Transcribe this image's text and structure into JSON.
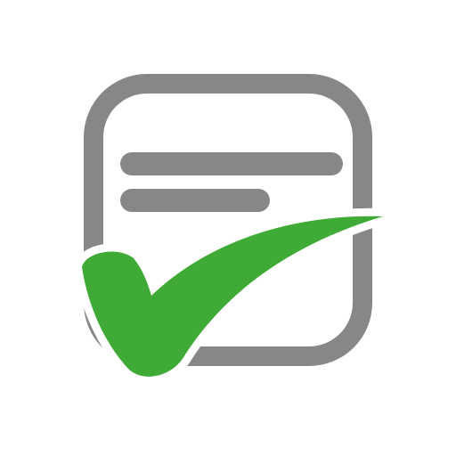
{
  "icon": {
    "name": "checklist-approved-icon",
    "colors": {
      "frame": "#868787",
      "lines": "#868787",
      "check": "#3faa35",
      "check_outline": "#ffffff",
      "background": "#ffffff"
    }
  }
}
